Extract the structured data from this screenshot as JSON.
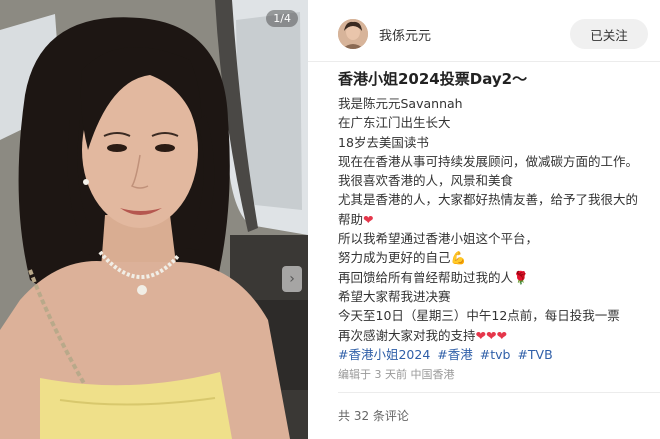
{
  "photo": {
    "counter": "1/4",
    "next_icon": "chevron-right-icon"
  },
  "author": {
    "name": "我係元元",
    "follow_label": "已关注"
  },
  "post": {
    "title": "香港小姐2024投票Day2～",
    "lines": [
      "我是陈元元Savannah",
      "在广东江门出生长大",
      "18岁去美国读书",
      "现在在香港从事可持续发展顾问，做减碳方面的工作。",
      "我很喜欢香港的人，风景和美食",
      "尤其是香港的人，大家都好热情友善，给予了我很大的",
      "帮助",
      "所以我希望通过香港小姐这个平台，",
      "努力成为更好的自己",
      "再回馈给所有曾经帮助过我的人",
      "希望大家帮我进决赛",
      "今天至10日（星期三）中午12点前，每日投我一票",
      "再次感谢大家对我的支持"
    ],
    "emoji": {
      "heart": "❤",
      "muscle": "💪",
      "rose": "🌹",
      "hearts": "❤❤❤"
    },
    "tags": [
      "#香港小姐2024",
      "#香港",
      "#tvb",
      "#TVB"
    ],
    "meta": "编辑于 3 天前 中国香港",
    "comment_count": "共 32 条评论"
  },
  "colors": {
    "tag_blue": "#2f5fa8",
    "heart_red": "#e5374b",
    "dress_yellow": "#efe08a"
  }
}
